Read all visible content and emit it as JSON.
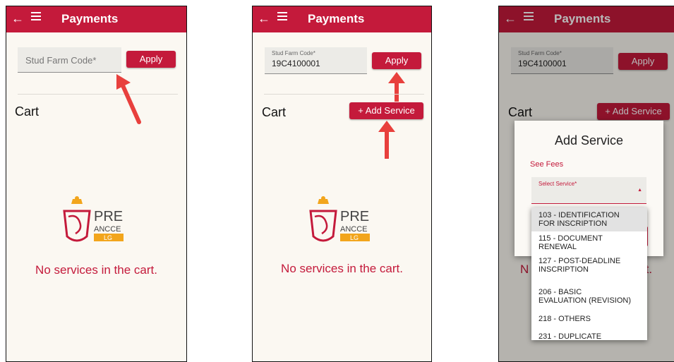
{
  "app": {
    "title": "Payments"
  },
  "screen1": {
    "field_placeholder": "Stud Farm Code*",
    "apply_label": "Apply",
    "cart_label": "Cart",
    "empty_message": "No services in the cart."
  },
  "screen2": {
    "field_label": "Stud Farm Code*",
    "field_value": "19C4100001",
    "apply_label": "Apply",
    "cart_label": "Cart",
    "add_service_label": "+ Add Service",
    "empty_message": "No services in the cart."
  },
  "screen3": {
    "field_label": "Stud Farm Code*",
    "field_value": "19C4100001",
    "apply_label": "Apply",
    "cart_label": "Cart",
    "add_service_label": "+ Add Service",
    "empty_left": "N",
    "empty_right": "rt.",
    "dialog": {
      "title": "Add Service",
      "see_fees": "See Fees",
      "select_label": "Select Service*"
    },
    "options": [
      {
        "line1": "103 - IDENTIFICATION",
        "line2": "FOR INSCRIPTION"
      },
      {
        "line1": "115 - DOCUMENT",
        "line2": "RENEWAL"
      },
      {
        "line1": "127 - POST-DEADLINE",
        "line2": "INSCRIPTION"
      },
      {
        "line1": "206 - BASIC",
        "line2": "EVALUATION (REVISION)"
      },
      {
        "line1": "218 - OTHERS",
        "line2": ""
      },
      {
        "line1": "231 - DUPLICATE",
        "line2": ""
      }
    ]
  },
  "logo": {
    "line1": "PRE",
    "line2": "ANCCE",
    "line3": "LG"
  },
  "colors": {
    "primary": "#c41a3b",
    "background": "#fbf8f2",
    "logo_gold": "#f2a51c",
    "arrow": "#e8403d"
  }
}
